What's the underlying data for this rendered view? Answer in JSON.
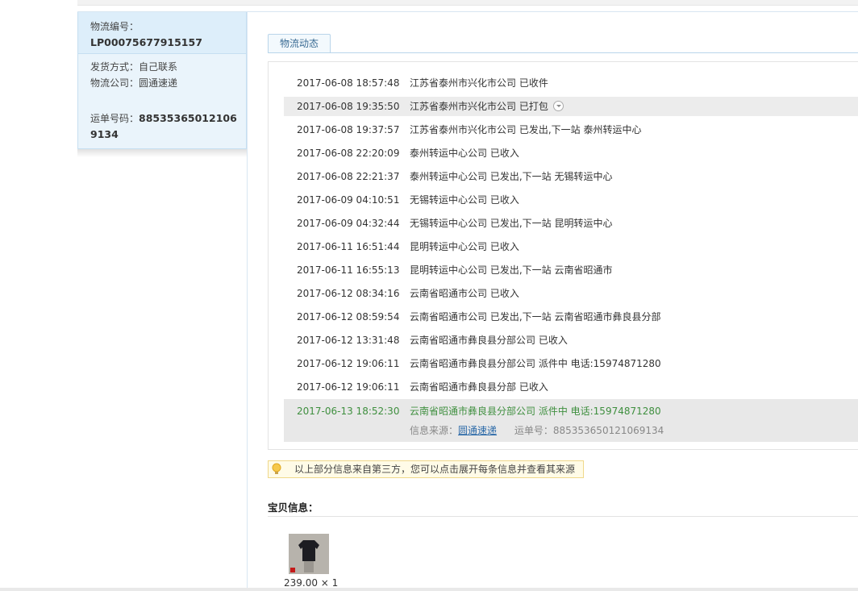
{
  "left_panel": {
    "logistics_no_label": "物流编号：",
    "logistics_no": "LP00075677915157",
    "ship_method": "发货方式：自己联系",
    "carrier": "物流公司：圆通速递",
    "waybill_label": "运单号码：",
    "waybill_no": "885353650121069134"
  },
  "tab": {
    "label": "物流动态"
  },
  "tracking": [
    {
      "time": "2017-06-08 18:57:48",
      "desc": "江苏省泰州市兴化市公司 已收件"
    },
    {
      "time": "2017-06-08 19:35:50",
      "desc": "江苏省泰州市兴化市公司 已打包"
    },
    {
      "time": "2017-06-08 19:37:57",
      "desc": "江苏省泰州市兴化市公司 已发出,下一站 泰州转运中心"
    },
    {
      "time": "2017-06-08 22:20:09",
      "desc": "泰州转运中心公司 已收入"
    },
    {
      "time": "2017-06-08 22:21:37",
      "desc": "泰州转运中心公司 已发出,下一站 无锡转运中心"
    },
    {
      "time": "2017-06-09 04:10:51",
      "desc": "无锡转运中心公司 已收入"
    },
    {
      "time": "2017-06-09 04:32:44",
      "desc": "无锡转运中心公司 已发出,下一站 昆明转运中心"
    },
    {
      "time": "2017-06-11 16:51:44",
      "desc": "昆明转运中心公司 已收入"
    },
    {
      "time": "2017-06-11 16:55:13",
      "desc": "昆明转运中心公司 已发出,下一站 云南省昭通市"
    },
    {
      "time": "2017-06-12 08:34:16",
      "desc": "云南省昭通市公司 已收入"
    },
    {
      "time": "2017-06-12 08:59:54",
      "desc": "云南省昭通市公司 已发出,下一站 云南省昭通市彝良县分部"
    },
    {
      "time": "2017-06-12 13:31:48",
      "desc": "云南省昭通市彝良县分部公司 已收入"
    },
    {
      "time": "2017-06-12 19:06:11",
      "desc": "云南省昭通市彝良县分部公司 派件中 电话:15974871280"
    },
    {
      "time": "2017-06-12 19:06:11",
      "desc": "云南省昭通市彝良县分部 已收入"
    }
  ],
  "latest": {
    "time": "2017-06-13 18:52:30",
    "desc": "云南省昭通市彝良县分部公司 派件中 电话:15974871280",
    "source_label": "信息来源：",
    "source_link": "圆通速递",
    "waybill_text": "运单号：885353650121069134"
  },
  "notice": {
    "text": "以上部分信息来自第三方，您可以点击展开每条信息并查看其来源"
  },
  "product": {
    "title": "宝贝信息：",
    "price_qty": "239.00 × 1"
  },
  "colors": {
    "accent_green": "#3f8f3f",
    "link_blue": "#2c6aa8",
    "panel_blue": "#eaf4fb"
  }
}
